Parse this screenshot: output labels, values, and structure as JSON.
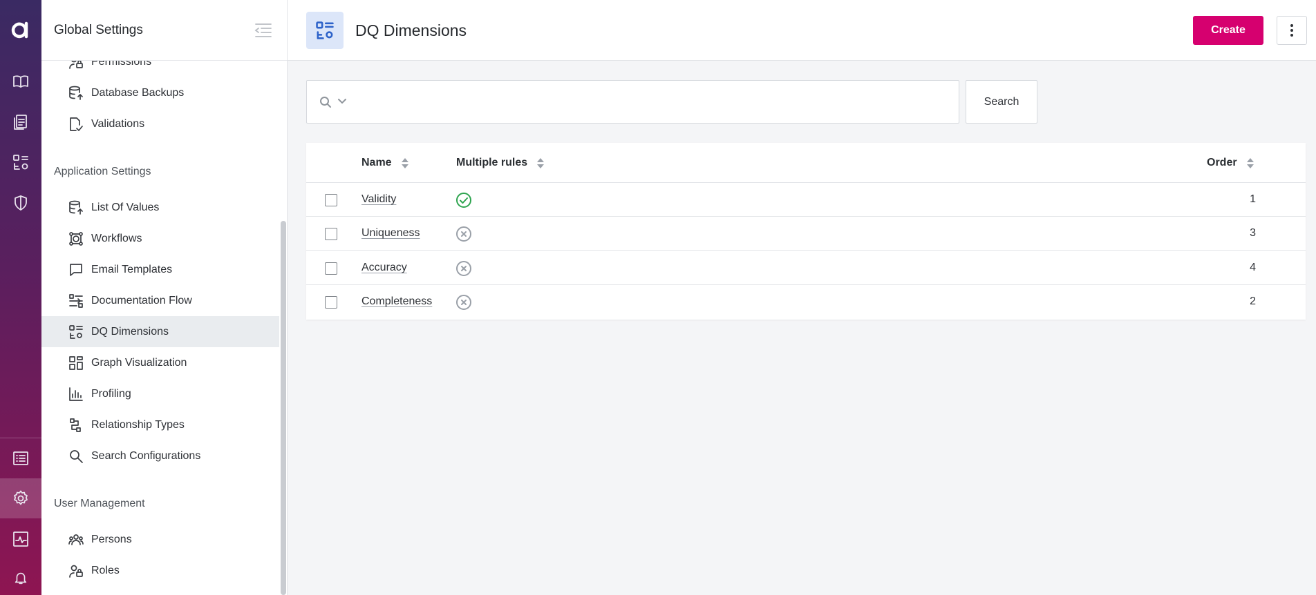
{
  "sidebar": {
    "title": "Global Settings",
    "items_top": [
      {
        "label": "Permissions",
        "icon": "permissions-icon"
      },
      {
        "label": "Database Backups",
        "icon": "database-backup-icon"
      },
      {
        "label": "Validations",
        "icon": "validations-icon"
      }
    ],
    "section_app": "Application Settings",
    "items_app": [
      {
        "label": "List Of Values",
        "icon": "list-of-values-icon"
      },
      {
        "label": "Workflows",
        "icon": "workflows-icon"
      },
      {
        "label": "Email Templates",
        "icon": "email-templates-icon"
      },
      {
        "label": "Documentation Flow",
        "icon": "documentation-flow-icon"
      },
      {
        "label": "DQ Dimensions",
        "icon": "dq-dimensions-icon",
        "active": true
      },
      {
        "label": "Graph Visualization",
        "icon": "graph-visualization-icon"
      },
      {
        "label": "Profiling",
        "icon": "profiling-icon"
      },
      {
        "label": "Relationship Types",
        "icon": "relationship-types-icon"
      },
      {
        "label": "Search Configurations",
        "icon": "search-configurations-icon"
      }
    ],
    "section_users": "User Management",
    "items_users": [
      {
        "label": "Persons",
        "icon": "persons-icon"
      },
      {
        "label": "Roles",
        "icon": "roles-icon"
      }
    ]
  },
  "header": {
    "title": "DQ Dimensions",
    "create_label": "Create"
  },
  "search": {
    "value": "",
    "button_label": "Search"
  },
  "table": {
    "columns": {
      "name": "Name",
      "multiple_rules": "Multiple rules",
      "order": "Order"
    },
    "rows": [
      {
        "name": "Validity",
        "multiple_rules": true,
        "order": "1"
      },
      {
        "name": "Uniqueness",
        "multiple_rules": false,
        "order": "3"
      },
      {
        "name": "Accuracy",
        "multiple_rules": false,
        "order": "4"
      },
      {
        "name": "Completeness",
        "multiple_rules": false,
        "order": "2"
      }
    ]
  },
  "colors": {
    "accent": "#d6006f",
    "rail_top": "#3a2a63",
    "rail_bottom": "#8e1552",
    "status_yes": "#2ea44f",
    "status_no": "#9aa0a8"
  }
}
